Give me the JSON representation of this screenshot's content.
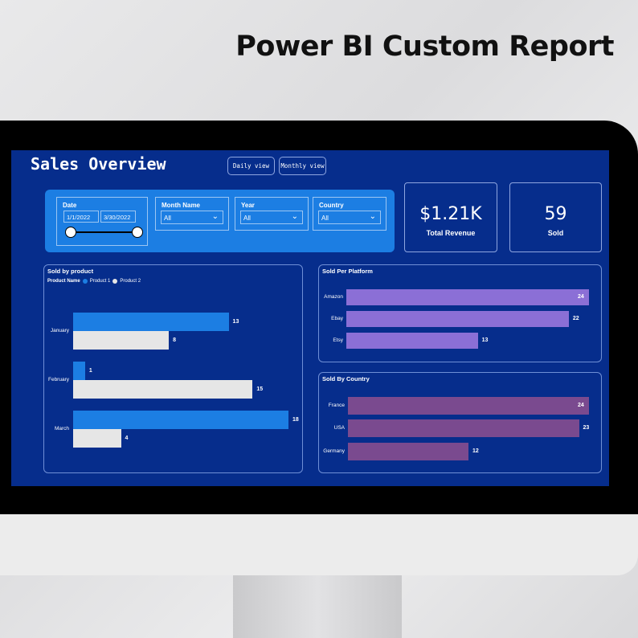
{
  "headline": "Power BI Custom Report",
  "report": {
    "title": "Sales Overview",
    "buttons": [
      "Daily view",
      "Monthly view"
    ],
    "filters": {
      "date": {
        "label": "Date",
        "start": "1/1/2022",
        "end": "3/30/2022"
      },
      "month": {
        "label": "Month Name",
        "value": "All"
      },
      "year": {
        "label": "Year",
        "value": "All"
      },
      "country": {
        "label": "Country",
        "value": "All"
      }
    },
    "cards": [
      {
        "value": "$1.21K",
        "label": "Total Revenue"
      },
      {
        "value": "59",
        "label": "Sold"
      }
    ]
  },
  "colors": {
    "background": "#062d8c",
    "filter_panel": "#1c7ee3",
    "product1": "#1c7ee3",
    "product2": "#e6e6e6",
    "platform": "#8b6fd6",
    "country": "#7a4a8f"
  },
  "chart_data": [
    {
      "type": "bar",
      "orientation": "horizontal",
      "title": "Sold by product",
      "legend_title": "Product Name",
      "legend_position": "top-left",
      "categories": [
        "January",
        "February",
        "March"
      ],
      "series": [
        {
          "name": "Product 1",
          "values": [
            13,
            1,
            18
          ]
        },
        {
          "name": "Product 2",
          "values": [
            8,
            15,
            4
          ]
        }
      ]
    },
    {
      "type": "bar",
      "orientation": "horizontal",
      "title": "Sold Per Platform",
      "categories": [
        "Amazon",
        "Ebay",
        "Etsy"
      ],
      "values": [
        24,
        22,
        13
      ]
    },
    {
      "type": "bar",
      "orientation": "horizontal",
      "title": "Sold By Country",
      "categories": [
        "France",
        "USA",
        "Germany"
      ],
      "values": [
        24,
        23,
        12
      ]
    }
  ]
}
